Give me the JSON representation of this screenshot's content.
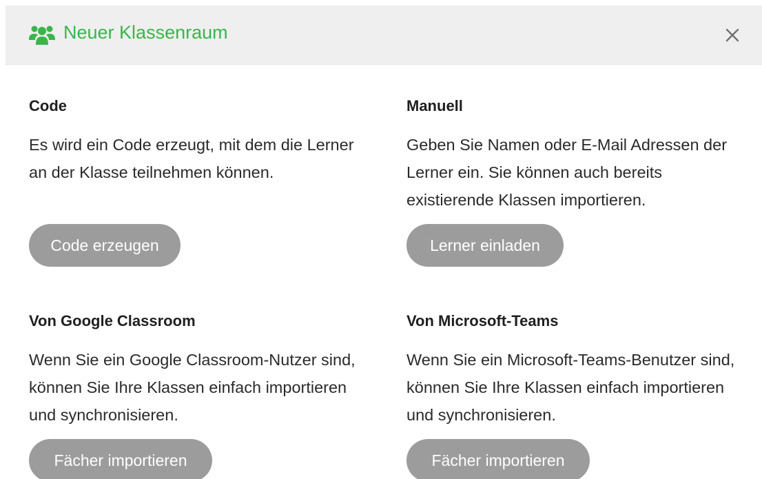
{
  "header": {
    "title": "Neuer Klassenraum",
    "icon": "users-icon",
    "accent_color": "#3ab54a",
    "close_icon": "close-icon"
  },
  "options": [
    {
      "title": "Code",
      "description": "Es wird ein Code erzeugt, mit dem die Lerner an der Klasse teilnehmen können.",
      "button_label": "Code erzeugen"
    },
    {
      "title": "Manuell",
      "description": "Geben Sie Namen oder E-Mail Adressen der Lerner ein. Sie können auch bereits existierende Klassen importieren.",
      "button_label": "Lerner einladen"
    },
    {
      "title": "Von Google Classroom",
      "description": "Wenn Sie ein Google Classroom-Nutzer sind, können Sie Ihre Klassen einfach importieren und synchronisieren.",
      "button_label": "Fächer importieren"
    },
    {
      "title": "Von Microsoft-Teams",
      "description": "Wenn Sie ein Microsoft-Teams-Benutzer sind, können Sie Ihre Klassen einfach importieren und synchronisieren.",
      "button_label": "Fächer importieren"
    }
  ],
  "colors": {
    "button_bg": "#9c9c9c",
    "header_bg": "#efefef"
  }
}
